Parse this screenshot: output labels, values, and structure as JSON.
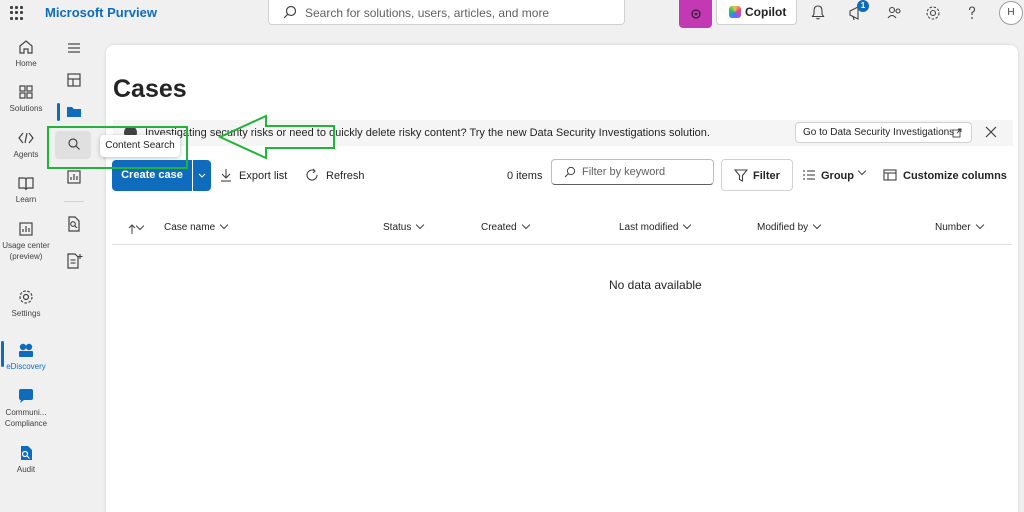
{
  "app": {
    "title": "Microsoft Purview"
  },
  "search": {
    "placeholder": "Search for solutions, users, articles, and more"
  },
  "topbar": {
    "copilot_label": "Copilot",
    "notification_count": "1",
    "avatar_initial": "H"
  },
  "rail": {
    "items": [
      {
        "label": "Home",
        "icon": "home-icon"
      },
      {
        "label": "Solutions",
        "icon": "solutions-icon"
      },
      {
        "label": "Agents",
        "icon": "agents-icon"
      },
      {
        "label": "Learn",
        "icon": "learn-icon"
      },
      {
        "label": "Usage center (preview)",
        "icon": "usage-center-icon"
      },
      {
        "label": "Settings",
        "icon": "gear-icon"
      },
      {
        "label": "eDiscovery",
        "icon": "ediscovery-icon",
        "active": true
      },
      {
        "label": "Communi... Compliance",
        "icon": "communication-compliance-icon"
      },
      {
        "label": "Audit",
        "icon": "audit-icon"
      }
    ]
  },
  "tooltip": {
    "text": "Content Search"
  },
  "page": {
    "title": "Cases"
  },
  "banner": {
    "text": "Investigating security risks or need to quickly delete risky content? Try the new Data Security Investigations solution.",
    "link_label": "Go to Data Security Investigations"
  },
  "toolbar": {
    "create_label": "Create case",
    "export_label": "Export list",
    "refresh_label": "Refresh",
    "items_count": "0 items",
    "filter_placeholder": "Filter by keyword",
    "filter_label": "Filter",
    "group_label": "Group",
    "customize_label": "Customize columns"
  },
  "table": {
    "columns": [
      "Case name",
      "Status",
      "Created",
      "Last modified",
      "Modified by",
      "Number"
    ],
    "empty_text": "No data available"
  },
  "colors": {
    "accent": "#0f6cbd",
    "annotation": "#22b33a",
    "copilot_accent": "#c239b3"
  }
}
